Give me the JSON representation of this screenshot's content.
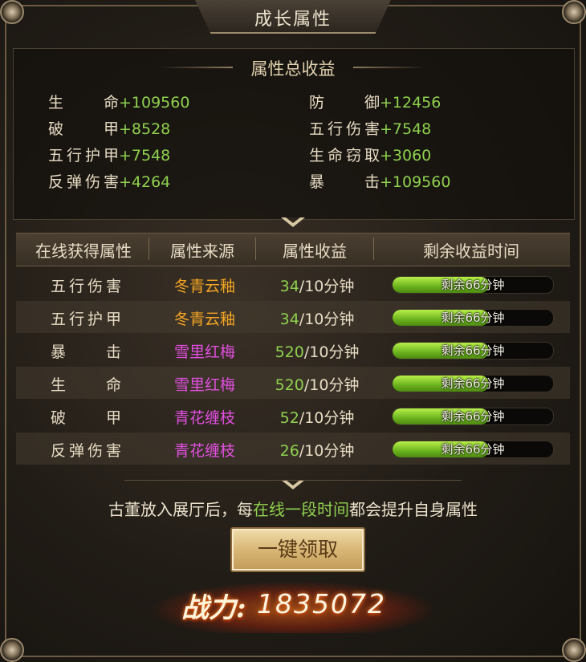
{
  "panel": {
    "title": "成长属性"
  },
  "summary": {
    "title": "属性总收益",
    "stats": [
      {
        "label": "生命",
        "value": "+109560"
      },
      {
        "label": "防御",
        "value": "+12456"
      },
      {
        "label": "破甲",
        "value": "+8528"
      },
      {
        "label": "五行伤害",
        "value": "+7548"
      },
      {
        "label": "五行护甲",
        "value": "+7548"
      },
      {
        "label": "生命窃取",
        "value": "+3060"
      },
      {
        "label": "反弹伤害",
        "value": "+4264"
      },
      {
        "label": "暴击",
        "value": "+109560"
      }
    ]
  },
  "table": {
    "headers": [
      "在线获得属性",
      "属性来源",
      "属性收益",
      "剩余收益时间"
    ],
    "rows": [
      {
        "attr": "五行伤害",
        "source": "冬青云釉",
        "source_color": "#f5a623",
        "gain": "34",
        "gain_unit": "/10分钟",
        "remaining": "剩余66分钟",
        "progress": 0.6
      },
      {
        "attr": "五行护甲",
        "source": "冬青云釉",
        "source_color": "#f5a623",
        "gain": "34",
        "gain_unit": "/10分钟",
        "remaining": "剩余66分钟",
        "progress": 0.6
      },
      {
        "attr": "暴击",
        "source": "雪里红梅",
        "source_color": "#e24fe0",
        "gain": "520",
        "gain_unit": "/10分钟",
        "remaining": "剩余66分钟",
        "progress": 0.6
      },
      {
        "attr": "生命",
        "source": "雪里红梅",
        "source_color": "#e24fe0",
        "gain": "520",
        "gain_unit": "/10分钟",
        "remaining": "剩余66分钟",
        "progress": 0.6
      },
      {
        "attr": "破甲",
        "source": "青花缠枝",
        "source_color": "#e24fe0",
        "gain": "52",
        "gain_unit": "/10分钟",
        "remaining": "剩余66分钟",
        "progress": 0.6
      },
      {
        "attr": "反弹伤害",
        "source": "青花缠枝",
        "source_color": "#e24fe0",
        "gain": "26",
        "gain_unit": "/10分钟",
        "remaining": "剩余66分钟",
        "progress": 0.6
      }
    ]
  },
  "hint": {
    "before": "古董放入展厅后，每",
    "highlight": "在线一段时间",
    "after": "都会提升自身属性"
  },
  "claim_button": {
    "label": "一键领取"
  },
  "combat_power": {
    "label": "战力:",
    "value": "1835072"
  },
  "colors": {
    "accent_green": "#8fd14f",
    "orange_quality": "#f5a623",
    "purple_quality": "#e24fe0"
  }
}
